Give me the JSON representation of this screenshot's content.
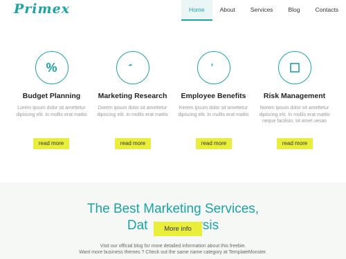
{
  "header": {
    "logo": "Primex",
    "nav": [
      "Home",
      "About",
      "Services",
      "Blog",
      "Contacts"
    ]
  },
  "cards": [
    {
      "icon": "percent-icon",
      "glyph": "%",
      "title": "Budget Planning",
      "text": "Lorem ipsum dolor sit amettetur dipiscing elit. In mollis erat mattis",
      "button": "read more"
    },
    {
      "icon": "chart-icon",
      "glyph": "",
      "title": "Marketing Research",
      "text": "Dorem ipsum dolor sit amettetur dipiscing elit. In mollis erat mattis",
      "button": "read more"
    },
    {
      "icon": "people-icon",
      "glyph": "",
      "title": "Employee Benefits",
      "text": "Kerem ipsum dolor sit amettetur dipiscing elit. In mollis erat mattis",
      "button": "read more"
    },
    {
      "icon": "square-icon",
      "glyph": "",
      "title": "Risk Management",
      "text": "Norem ipsum dolor sit amettetur dipiscing elit. In mollis erat mattis neque facilisis, sit amet uesas",
      "button": "read more"
    }
  ],
  "promo": {
    "title_line1": "The Best Marketing Services,",
    "title_line2_left": "Dat",
    "title_line2_right": "ysis",
    "more_button": "More info",
    "text_line1": "Visit our official blog for more detailed information about this freebie.",
    "text_line2": "Want more business themes ? Check out the same name category at TemplateMonster."
  },
  "colors": {
    "accent": "#1aa3a3",
    "button": "#e9ee3a",
    "promo_bg": "#f6f8f6"
  }
}
